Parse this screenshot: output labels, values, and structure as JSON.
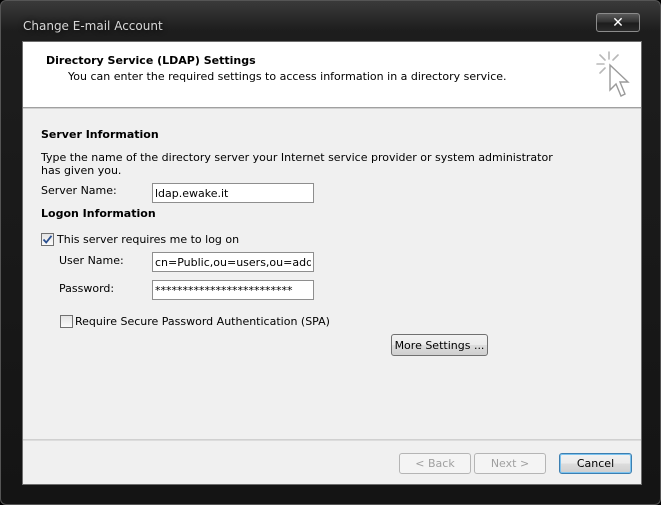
{
  "window": {
    "title": "Change E-mail Account",
    "close_glyph": "✕"
  },
  "header": {
    "title": "Directory Service (LDAP) Settings",
    "subtitle": "You can enter the required settings to access information in a directory service.",
    "icon": "cursor-sparkle-icon"
  },
  "server_info": {
    "heading": "Server Information",
    "description_line1": "Type the name of the directory server your Internet service provider or system administrator",
    "description_line2": "has given you.",
    "server_name_label": "Server Name:",
    "server_name_value": "ldap.ewake.it"
  },
  "logon_info": {
    "heading": "Logon Information",
    "requires_logon_label": "This server requires me to log on",
    "requires_logon_checked": true,
    "user_name_label": "User Name:",
    "user_name_value": "cn=Public,ou=users,ou=address",
    "password_label": "Password:",
    "password_value": "*************************",
    "spa_label": "Require Secure Password Authentication (SPA)",
    "spa_checked": false
  },
  "buttons": {
    "more_settings": "More Settings ...",
    "back": "< Back",
    "next": "Next >",
    "cancel": "Cancel"
  },
  "colors": {
    "frame": "#1a1a1a",
    "client_bg": "#f0f0f0",
    "header_bg": "#ffffff",
    "check_mark": "#2a4f8f"
  }
}
